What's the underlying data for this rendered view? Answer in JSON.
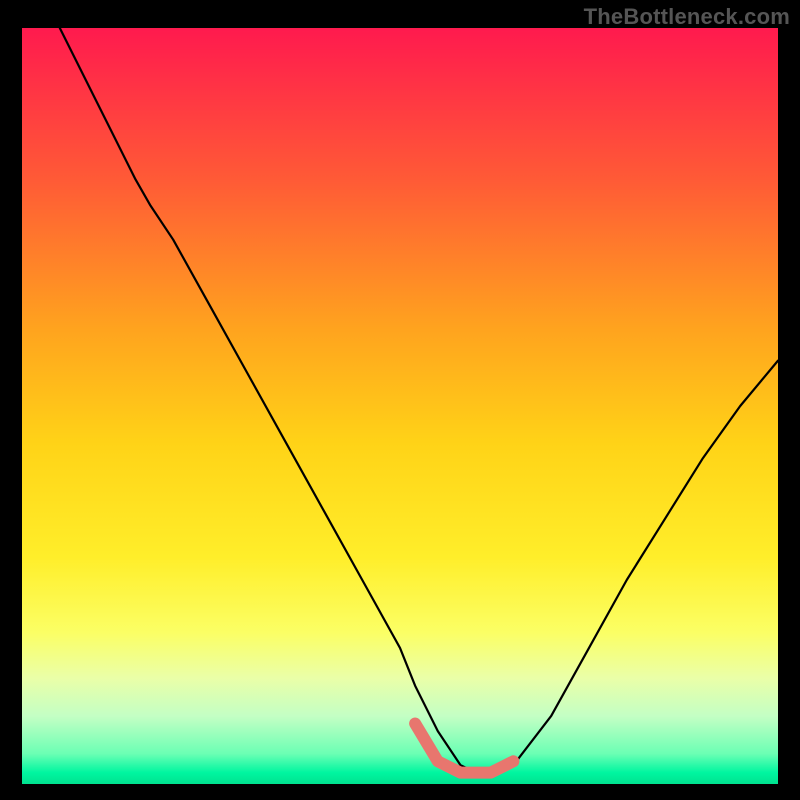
{
  "watermark": "TheBottleneck.com",
  "colors": {
    "background": "#000000",
    "curve": "#000000",
    "highlight": "#e8766e",
    "gradient_stops": [
      {
        "offset": 0.0,
        "color": "#ff1a4e"
      },
      {
        "offset": 0.2,
        "color": "#ff5a36"
      },
      {
        "offset": 0.4,
        "color": "#ffa41e"
      },
      {
        "offset": 0.55,
        "color": "#ffd317"
      },
      {
        "offset": 0.7,
        "color": "#ffee2a"
      },
      {
        "offset": 0.8,
        "color": "#fbff65"
      },
      {
        "offset": 0.86,
        "color": "#eaffa8"
      },
      {
        "offset": 0.91,
        "color": "#c4ffc4"
      },
      {
        "offset": 0.96,
        "color": "#6bffb4"
      },
      {
        "offset": 0.985,
        "color": "#00f6a0"
      },
      {
        "offset": 1.0,
        "color": "#00e28f"
      }
    ]
  },
  "chart_data": {
    "type": "line",
    "title": "",
    "xlabel": "",
    "ylabel": "",
    "xlim": [
      0,
      100
    ],
    "ylim": [
      0,
      100
    ],
    "series": [
      {
        "name": "bottleneck-curve",
        "x": [
          5,
          10,
          15,
          17,
          20,
          25,
          30,
          35,
          40,
          45,
          50,
          52,
          55,
          58,
          60,
          62,
          65,
          70,
          75,
          80,
          85,
          90,
          95,
          100
        ],
        "y": [
          100,
          90,
          80,
          76.5,
          72,
          63,
          54,
          45,
          36,
          27,
          18,
          13,
          7,
          2.5,
          1.5,
          1.5,
          2.5,
          9,
          18,
          27,
          35,
          43,
          50,
          56
        ]
      }
    ],
    "highlight": {
      "name": "flat-minimum",
      "x": [
        52,
        55,
        58,
        60,
        62,
        65
      ],
      "y": [
        8,
        3,
        1.5,
        1.5,
        1.5,
        3
      ]
    }
  }
}
